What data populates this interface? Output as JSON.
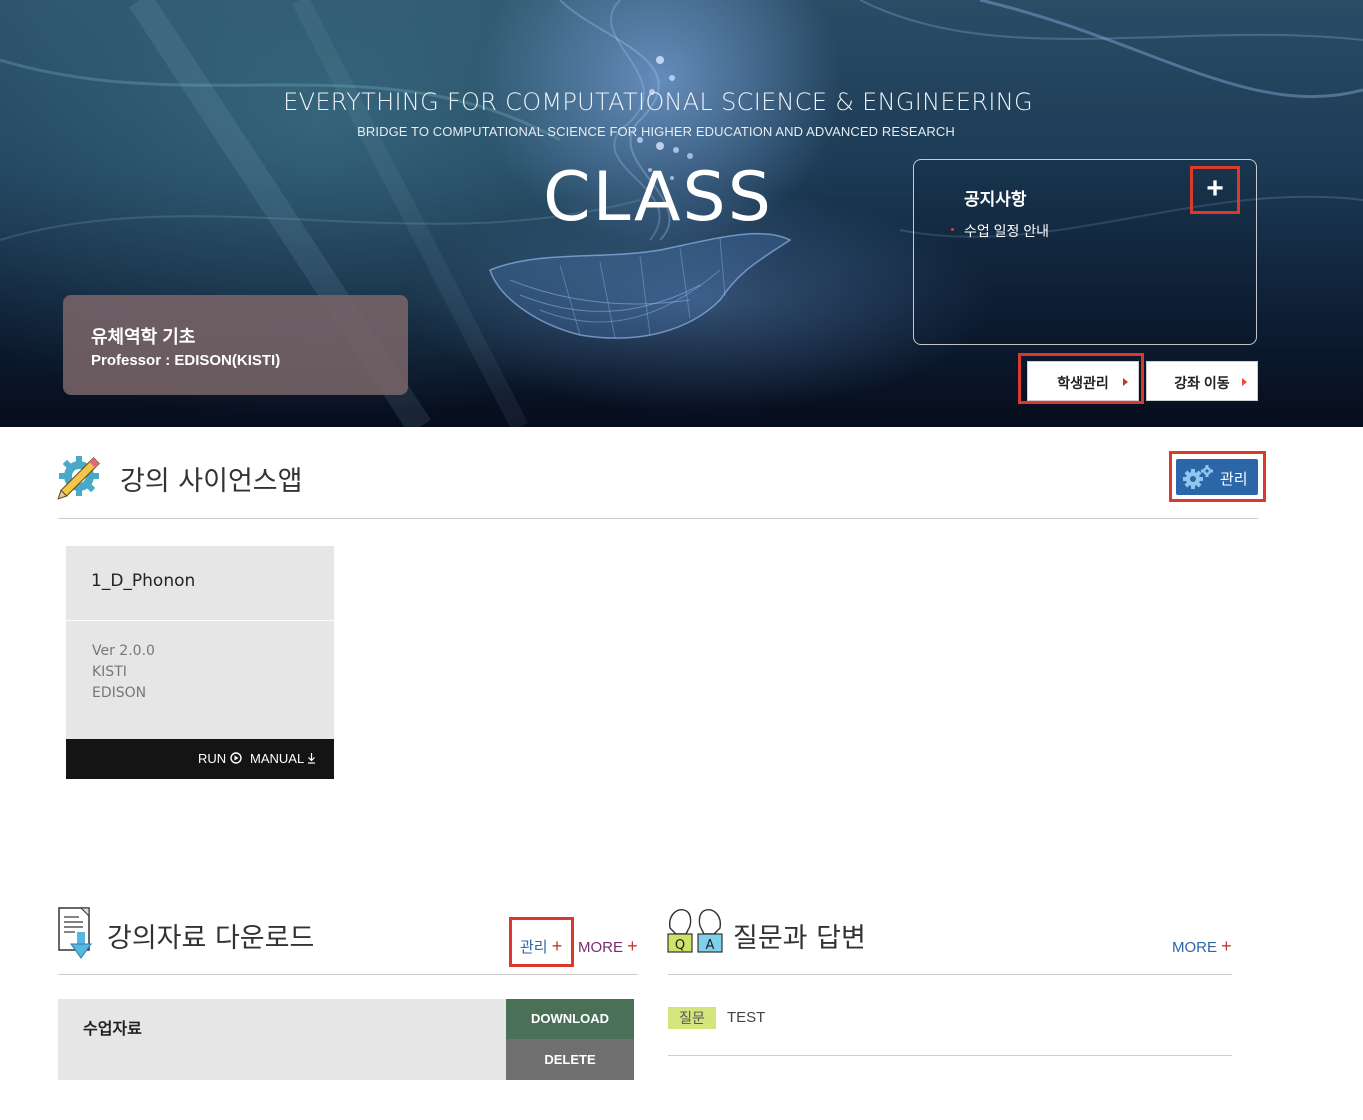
{
  "hero": {
    "title": "EVERYTHING FOR COMPUTATIONAL SCIENCE & ENGINEERING",
    "subtitle": "BRIDGE TO COMPUTATIONAL SCIENCE FOR HIGHER EDUCATION AND ADVANCED RESEARCH",
    "heading": "CLASS",
    "course": {
      "name": "유체역학 기초",
      "professor": "Professor : EDISON(KISTI)"
    },
    "notice": {
      "title": "공지사항",
      "items": [
        "수업 일정 안내"
      ],
      "add_icon": "plus-icon"
    },
    "buttons": {
      "student_manage": "학생관리",
      "course_move": "강좌 이동"
    }
  },
  "science_apps": {
    "title": "강의 사이언스앱",
    "icon": "gear-pencil-icon",
    "manage_label": "관리",
    "manage_icon": "gears-icon",
    "apps": [
      {
        "name": "1_D_Phonon",
        "version": "Ver 2.0.0",
        "org": "KISTI",
        "author": "EDISON",
        "run_label": "RUN",
        "manual_label": "MANUAL"
      }
    ]
  },
  "materials": {
    "title": "강의자료 다운로드",
    "icon": "document-download-icon",
    "manage_label": "관리",
    "more_label": "MORE",
    "files": [
      {
        "name": "수업자료",
        "download_label": "DOWNLOAD",
        "delete_label": "DELETE"
      }
    ]
  },
  "qna": {
    "title": "질문과 답변",
    "icon": "qa-people-icon",
    "more_label": "MORE",
    "items": [
      {
        "badge": "질문",
        "text": "TEST"
      }
    ]
  },
  "colors": {
    "highlight": "#d93a2b",
    "manage_button": "#2b66a8",
    "download_button": "#4a7058",
    "delete_button": "#6f6f6f",
    "question_badge": "#d5e47c",
    "link_blue": "#2b66a8",
    "link_purple": "#7a2d6b"
  }
}
